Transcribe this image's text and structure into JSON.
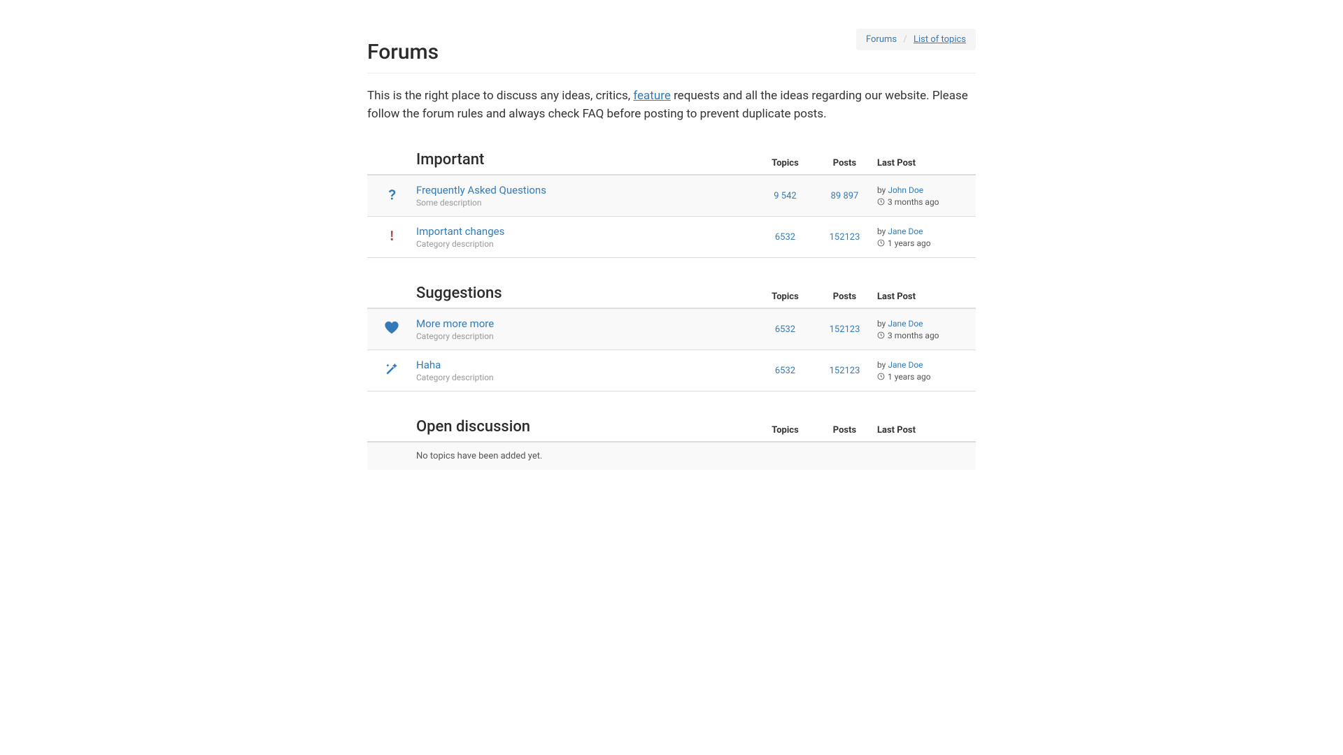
{
  "header": {
    "title": "Forums",
    "breadcrumb": {
      "root": "Forums",
      "current": "List of topics"
    },
    "intro_pre": "This is the right place to discuss any ideas, critics, ",
    "intro_link": "feature",
    "intro_post": " requests and all the ideas regarding our website. Please follow the forum rules and always check FAQ before posting to prevent duplicate posts."
  },
  "columns": {
    "topics": "Topics",
    "posts": "Posts",
    "last": "Last Post"
  },
  "by_label": "by ",
  "sections": [
    {
      "title": "Important",
      "rows": [
        {
          "icon": "question",
          "striped": true,
          "title": "Frequently Asked Questions",
          "desc": "Some description",
          "topics": "9 542",
          "posts": "89 897",
          "author": "John Doe",
          "time": "3 months ago"
        },
        {
          "icon": "exclaim",
          "striped": false,
          "title": "Important changes",
          "desc": "Category description",
          "topics": "6532",
          "posts": "152123",
          "author": "Jane Doe",
          "time": "1 years ago"
        }
      ]
    },
    {
      "title": "Suggestions",
      "rows": [
        {
          "icon": "heart",
          "striped": true,
          "title": "More more more",
          "desc": "Category description",
          "topics": "6532",
          "posts": "152123",
          "author": "Jane Doe",
          "time": "3 months ago"
        },
        {
          "icon": "wand",
          "striped": false,
          "title": "Haha",
          "desc": "Category description",
          "topics": "6532",
          "posts": "152123",
          "author": "Jane Doe",
          "time": "1 years ago"
        }
      ]
    },
    {
      "title": "Open discussion",
      "empty": "No topics have been added yet.",
      "rows": []
    }
  ]
}
